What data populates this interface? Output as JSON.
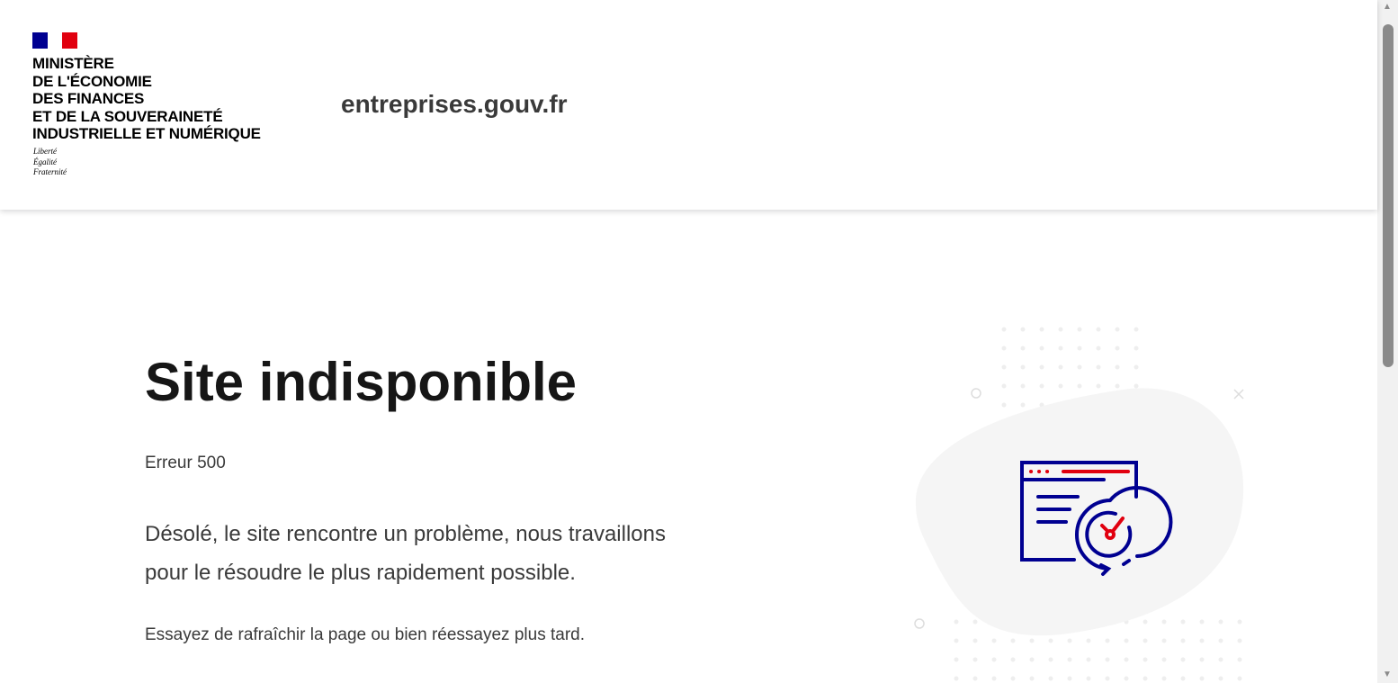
{
  "header": {
    "ministry_lines": [
      "MINISTÈRE",
      "DE L'ÉCONOMIE",
      "DES FINANCES",
      "ET DE LA SOUVERAINETÉ",
      "INDUSTRIELLE ET NUMÉRIQUE"
    ],
    "devise": [
      "Liberté",
      "Égalité",
      "Fraternité"
    ],
    "site_name": "entreprises.gouv.fr"
  },
  "main": {
    "title": "Site indisponible",
    "error_code": "Erreur 500",
    "lead_1": "Désolé, le site rencontre un problème, nous travaillons",
    "lead_2": "pour le résoudre le plus rapidement possible.",
    "hint": "Essayez de rafraîchir la page ou bien réessayez plus tard."
  },
  "colors": {
    "blue": "#000091",
    "red": "#e1000f",
    "blob": "#f5f5f5"
  }
}
